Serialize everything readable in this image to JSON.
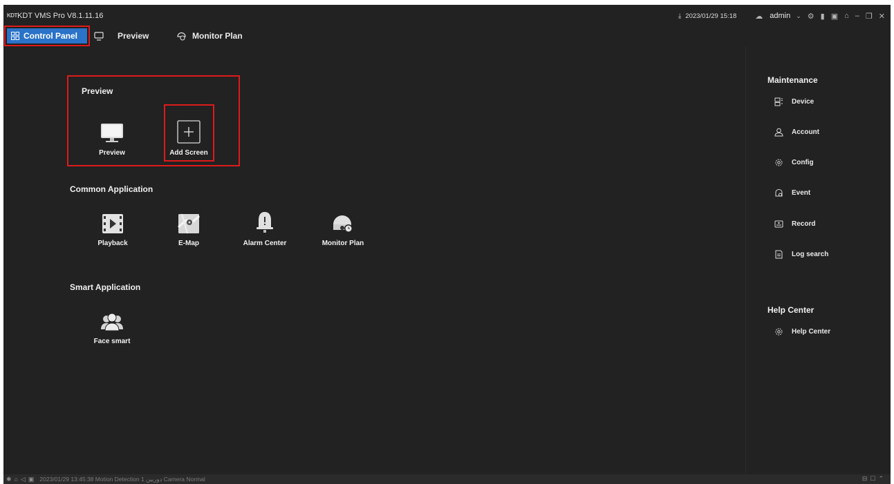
{
  "titlebar": {
    "logo": "KDT",
    "title": "KDT VMS Pro V8.1.11.16",
    "datetime": "2023/01/29 15:18",
    "user": "admin"
  },
  "nav": {
    "tabs": [
      {
        "label": "Control Panel",
        "active": true
      },
      {
        "label": "Preview"
      },
      {
        "label": "Monitor Plan"
      }
    ]
  },
  "main": {
    "preview_section": {
      "title": "Preview",
      "items": [
        {
          "label": "Preview",
          "icon": "monitor-icon"
        },
        {
          "label": "Add Screen",
          "icon": "plus-box-icon"
        }
      ]
    },
    "common_section": {
      "title": "Common Application",
      "items": [
        {
          "label": "Playback",
          "icon": "film-play-icon"
        },
        {
          "label": "E-Map",
          "icon": "map-icon"
        },
        {
          "label": "Alarm Center",
          "icon": "bell-icon"
        },
        {
          "label": "Monitor Plan",
          "icon": "dome-camera-clock-icon"
        }
      ]
    },
    "smart_section": {
      "title": "Smart Application",
      "items": [
        {
          "label": "Face smart",
          "icon": "people-icon"
        }
      ]
    }
  },
  "sidebar": {
    "maintenance_title": "Maintenance",
    "maintenance_items": [
      {
        "label": "Device",
        "icon": "device-icon"
      },
      {
        "label": "Account",
        "icon": "user-icon"
      },
      {
        "label": "Config",
        "icon": "gear-icon"
      },
      {
        "label": "Event",
        "icon": "event-icon"
      },
      {
        "label": "Record",
        "icon": "record-icon"
      },
      {
        "label": "Log search",
        "icon": "document-icon"
      }
    ],
    "help_title": "Help Center",
    "help_items": [
      {
        "label": "Help Center",
        "icon": "gear-icon"
      }
    ]
  },
  "statusbar": {
    "text": "2023/01/29 13:45:38   Motion Detection   1 دوربین Camera   Normal"
  },
  "colors": {
    "background": "#222222",
    "accent": "#2a73c8",
    "highlight": "#e01a1a"
  }
}
